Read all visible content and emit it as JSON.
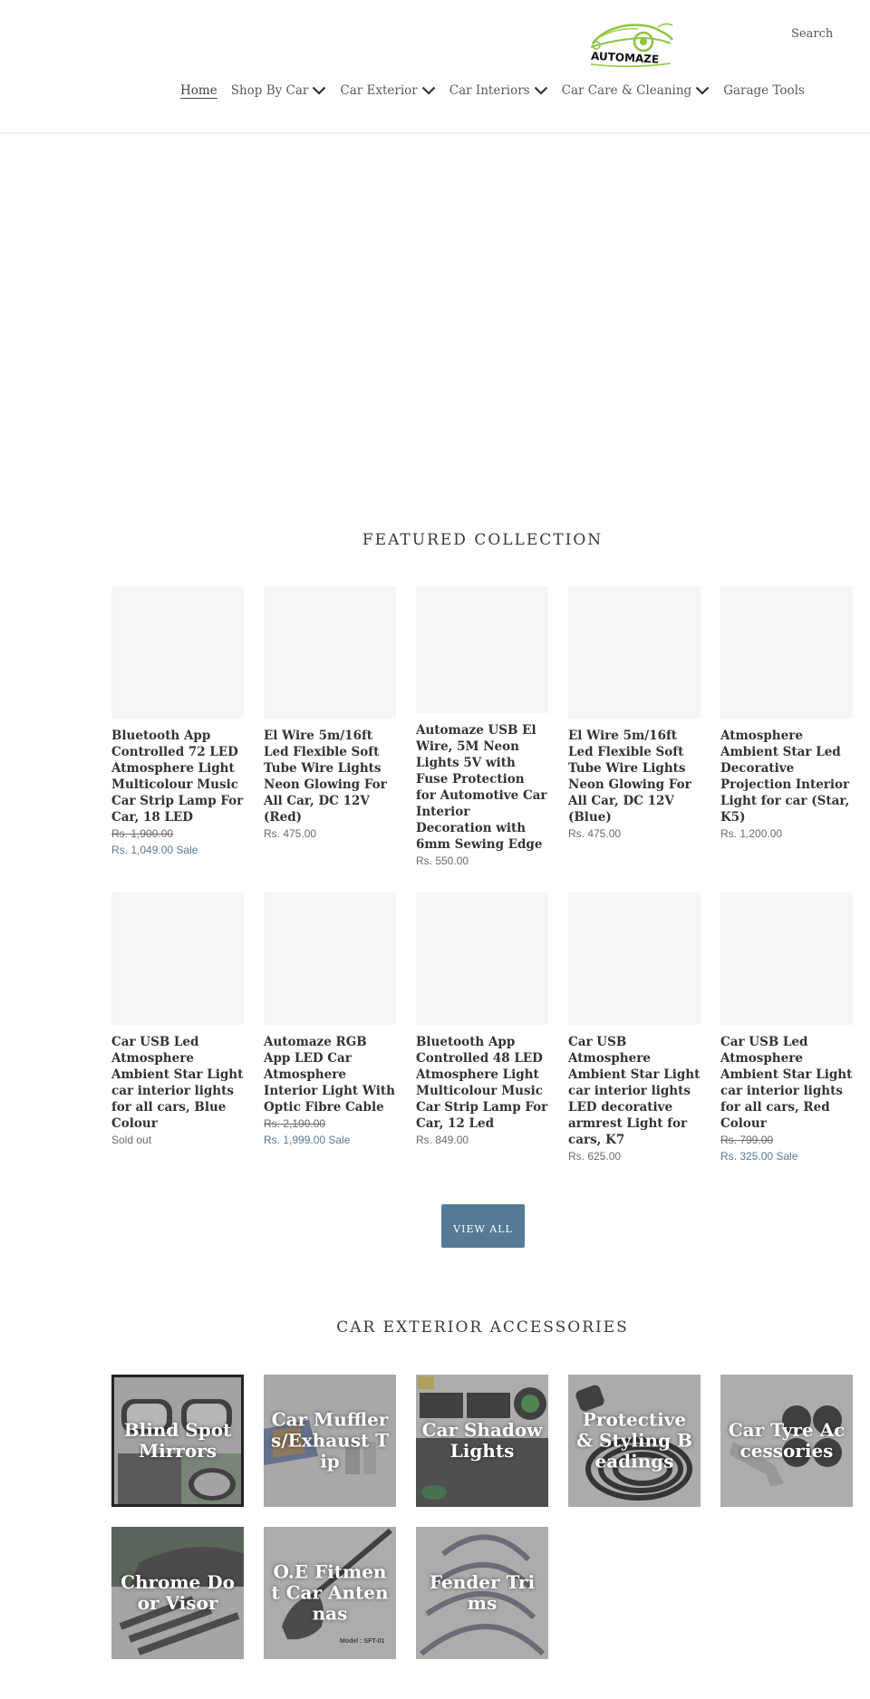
{
  "header": {
    "logo_text": "AUTOMAZE",
    "search_label": "Search",
    "nav": [
      {
        "label": "Home",
        "active": true,
        "dropdown": false
      },
      {
        "label": "Shop By Car",
        "active": false,
        "dropdown": true
      },
      {
        "label": "Car Exterior",
        "active": false,
        "dropdown": true
      },
      {
        "label": "Car Interiors",
        "active": false,
        "dropdown": true
      },
      {
        "label": "Car Care & Cleaning",
        "active": false,
        "dropdown": true
      },
      {
        "label": "Garage Tools",
        "active": false,
        "dropdown": false
      }
    ]
  },
  "featured": {
    "title": "FEATURED COLLECTION",
    "products": [
      {
        "title": "Bluetooth App Controlled 72 LED Atmosphere Light Multicolour Music Car Strip Lamp For Car, 18 LED",
        "compare_price": "Rs. 1,900.00",
        "price": "Rs. 1,049.00 Sale"
      },
      {
        "title": "El Wire 5m/16ft Led Flexible Soft Tube Wire Lights Neon Glowing For All Car, DC 12V (Red)",
        "price": "Rs. 475.00"
      },
      {
        "title": "Automaze USB El Wire, 5M Neon Lights 5V with Fuse Protection for Automotive Car Interior Decoration with 6mm Sewing Edge",
        "price": "Rs. 550.00"
      },
      {
        "title": "El Wire 5m/16ft Led Flexible Soft Tube Wire Lights Neon Glowing For All Car, DC 12V (Blue)",
        "price": "Rs. 475.00"
      },
      {
        "title": "Atmosphere Ambient Star Led Decorative Projection Interior Light for car (Star, K5)",
        "price": "Rs. 1,200.00"
      },
      {
        "title": "Car USB Led Atmosphere Ambient Star Light car interior lights for all cars, Blue Colour",
        "price": "Sold out"
      },
      {
        "title": "Automaze RGB App LED Car Atmosphere Interior Light With Optic Fibre Cable",
        "compare_price": "Rs. 2,100.00",
        "price": "Rs. 1,999.00 Sale"
      },
      {
        "title": "Bluetooth App Controlled 48 LED Atmosphere Light Multicolour Music Car Strip Lamp For Car, 12 Led",
        "price": "Rs. 849.00"
      },
      {
        "title": "Car USB Atmosphere Ambient Star Light car interior lights LED decorative armrest Light for cars, K7",
        "price": "Rs. 625.00"
      },
      {
        "title": "Car USB Led Atmosphere Ambient Star Light car interior lights for all cars, Red Colour",
        "compare_price": "Rs. 799.00",
        "price": "Rs. 325.00 Sale"
      }
    ],
    "view_all_label": "VIEW ALL"
  },
  "exterior": {
    "title": "CAR EXTERIOR ACCESSORIES",
    "collections": [
      {
        "label": "Blind Spot Mirrors"
      },
      {
        "label": "Car Mufflers/Exhaust Tip"
      },
      {
        "label": "Car Shadow Lights"
      },
      {
        "label": "Protective & Styling Beadings"
      },
      {
        "label": "Car Tyre Accessories"
      },
      {
        "label": "Chrome Door Visor"
      },
      {
        "label": "O.E Fitment Car Antennas"
      },
      {
        "label": "Fender Trims"
      }
    ]
  },
  "colors": {
    "accent": "#557b97",
    "logo_green": "#8dc63f",
    "tile_placeholder": "#f6f6f6"
  }
}
